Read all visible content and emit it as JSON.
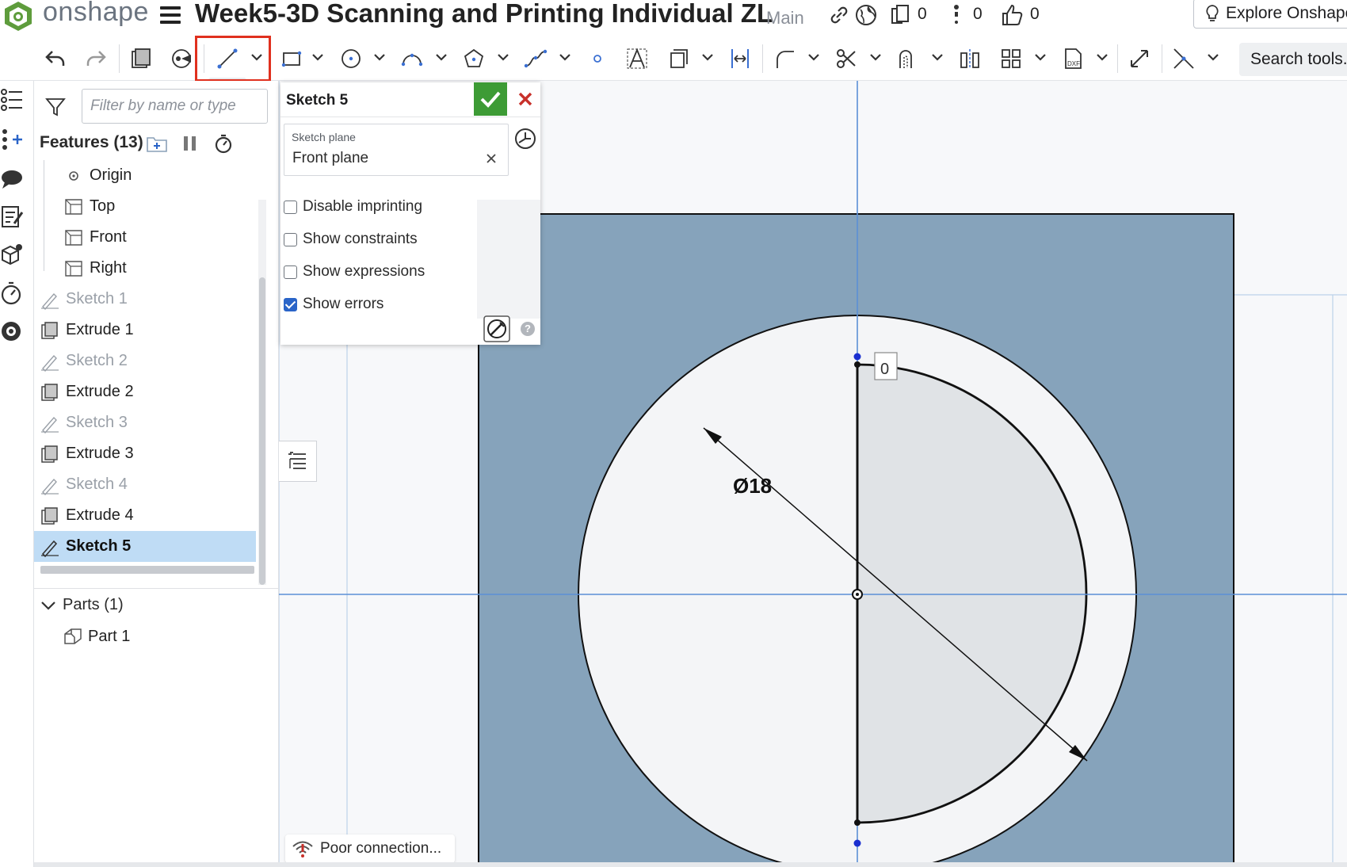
{
  "header": {
    "logo_text": "onshape",
    "document_title": "Week5-3D Scanning and Printing Individual ZL",
    "branch": "Main",
    "versions_count": "0",
    "info_count": "0",
    "likes_count": "0",
    "explore_label": "Explore Onshape"
  },
  "toolbar": {
    "search_label": "Search tools...",
    "active_tool": "line",
    "icons": [
      "undo-icon",
      "redo-icon",
      "extrude-icon",
      "sketch-tools-icon",
      "line-icon",
      "rectangle-icon",
      "circle-icon",
      "arc-icon",
      "polygon-icon",
      "spline-icon",
      "point-icon",
      "text-icon",
      "construction-icon",
      "dimension-icon",
      "fillet-icon",
      "trim-icon",
      "offset-icon",
      "mirror-icon",
      "pattern-icon",
      "dxf-import-icon",
      "transform-icon",
      "intersect-icon"
    ]
  },
  "feature_panel": {
    "filter_placeholder": "Filter by name or type",
    "features_label": "Features (13)",
    "items": [
      {
        "label": "Origin",
        "type": "origin"
      },
      {
        "label": "Top",
        "type": "plane"
      },
      {
        "label": "Front",
        "type": "plane"
      },
      {
        "label": "Right",
        "type": "plane"
      },
      {
        "label": "Sketch 1",
        "type": "sketch"
      },
      {
        "label": "Extrude 1",
        "type": "extrude"
      },
      {
        "label": "Sketch 2",
        "type": "sketch"
      },
      {
        "label": "Extrude 2",
        "type": "extrude"
      },
      {
        "label": "Sketch 3",
        "type": "sketch"
      },
      {
        "label": "Extrude 3",
        "type": "extrude"
      },
      {
        "label": "Sketch 4",
        "type": "sketch"
      },
      {
        "label": "Extrude 4",
        "type": "extrude"
      },
      {
        "label": "Sketch 5",
        "type": "sketch",
        "selected": true
      }
    ],
    "parts_label": "Parts (1)",
    "parts": [
      {
        "label": "Part 1"
      }
    ]
  },
  "sketch_dialog": {
    "title": "Sketch 5",
    "plane_label": "Sketch plane",
    "plane_value": "Front plane",
    "options": [
      {
        "label": "Disable imprinting",
        "checked": false
      },
      {
        "label": "Show constraints",
        "checked": false
      },
      {
        "label": "Show expressions",
        "checked": false
      },
      {
        "label": "Show errors",
        "checked": true
      }
    ]
  },
  "viewport": {
    "diameter_label": "Ø18",
    "constraint_label": "0",
    "colors": {
      "body_face": "#86a3bb",
      "sketch_region": "#e0e3e6",
      "axis": "#5b8fd6",
      "background": "#f7f8fa"
    }
  },
  "toast": {
    "message": "Poor connection..."
  }
}
